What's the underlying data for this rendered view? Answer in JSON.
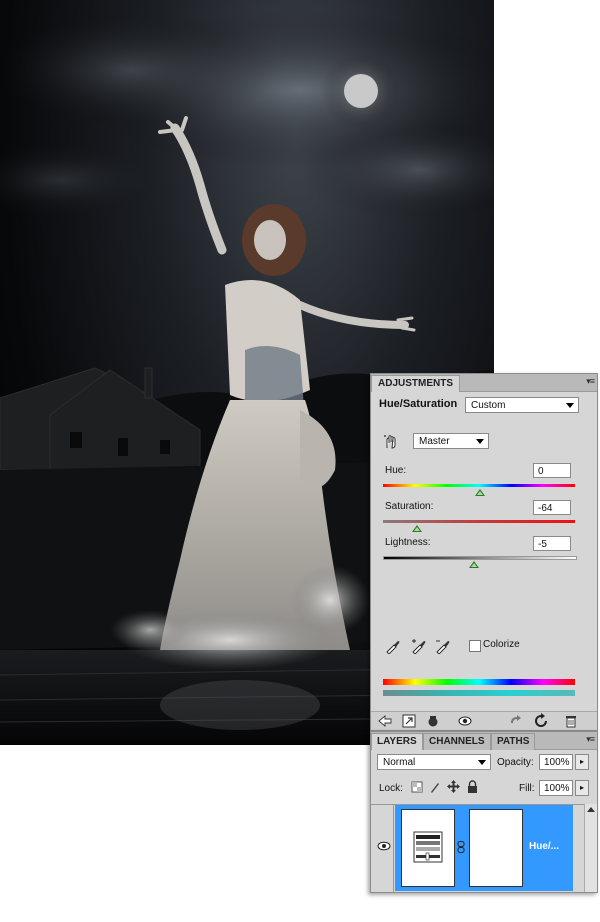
{
  "adjustments": {
    "tab_label": "ADJUSTMENTS",
    "title": "Hue/Saturation",
    "preset": "Custom",
    "channel": "Master",
    "hue": {
      "label": "Hue:",
      "value": "0"
    },
    "saturation": {
      "label": "Saturation:",
      "value": "-64"
    },
    "lightness": {
      "label": "Lightness:",
      "value": "-5"
    },
    "colorize_label": "Colorize",
    "colorize_checked": false
  },
  "layers": {
    "tabs": [
      "LAYERS",
      "CHANNELS",
      "PATHS"
    ],
    "blend_mode": "Normal",
    "opacity_label": "Opacity:",
    "opacity_value": "100%",
    "lock_label": "Lock:",
    "fill_label": "Fill:",
    "fill_value": "100%",
    "layer_name": "Hue/..."
  },
  "colors": {
    "panel_bg": "#d6d6d6",
    "selection": "#3399ff",
    "slider_thumb": "#2f7a2f"
  }
}
